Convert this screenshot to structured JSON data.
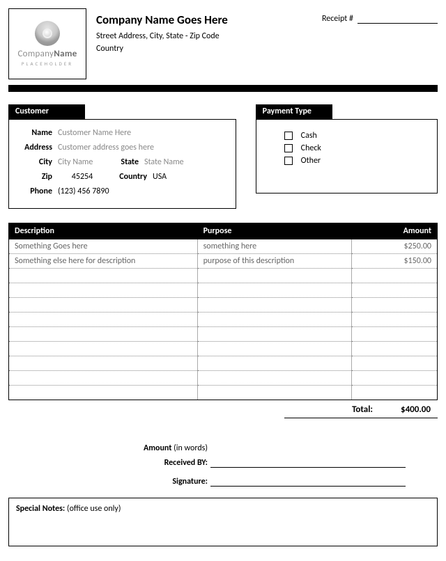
{
  "header": {
    "logo": {
      "line1a": "Company",
      "line1b": "Name",
      "line2": "PLACEHOLDER"
    },
    "company_name": "Company Name Goes Here",
    "address_line": "Street Address, City, State - Zip Code",
    "country_line": "Country",
    "receipt_label": "Receipt #",
    "receipt_value": ""
  },
  "customer": {
    "panel_title": "Customer",
    "labels": {
      "name": "Name",
      "address": "Address",
      "city": "City",
      "state": "State",
      "zip": "Zip",
      "country": "Country",
      "phone": "Phone"
    },
    "values": {
      "name": "Customer Name Here",
      "address": "Customer address goes here",
      "city": "City Name",
      "state": "State Name",
      "zip": "45254",
      "country": "USA",
      "phone": "(123) 456 7890"
    }
  },
  "payment": {
    "panel_title": "Payment Type",
    "options": [
      "Cash",
      "Check",
      "Other"
    ]
  },
  "table": {
    "headers": {
      "description": "Description",
      "purpose": "Purpose",
      "amount": "Amount"
    },
    "rows": [
      {
        "description": "Something Goes here",
        "purpose": "something here",
        "amount": "$250.00"
      },
      {
        "description": "Something else here for description",
        "purpose": "purpose of this description",
        "amount": "$150.00"
      }
    ],
    "blank_rows": 9,
    "total_label": "Total:",
    "total_value": "$400.00"
  },
  "signature": {
    "amount_label_bold": "Amount",
    "amount_label_rest": " (in words)",
    "received_by": "Received BY:",
    "signature": "Signature:"
  },
  "notes": {
    "label_bold": "Special Notes:",
    "label_rest": " (office use only)"
  }
}
